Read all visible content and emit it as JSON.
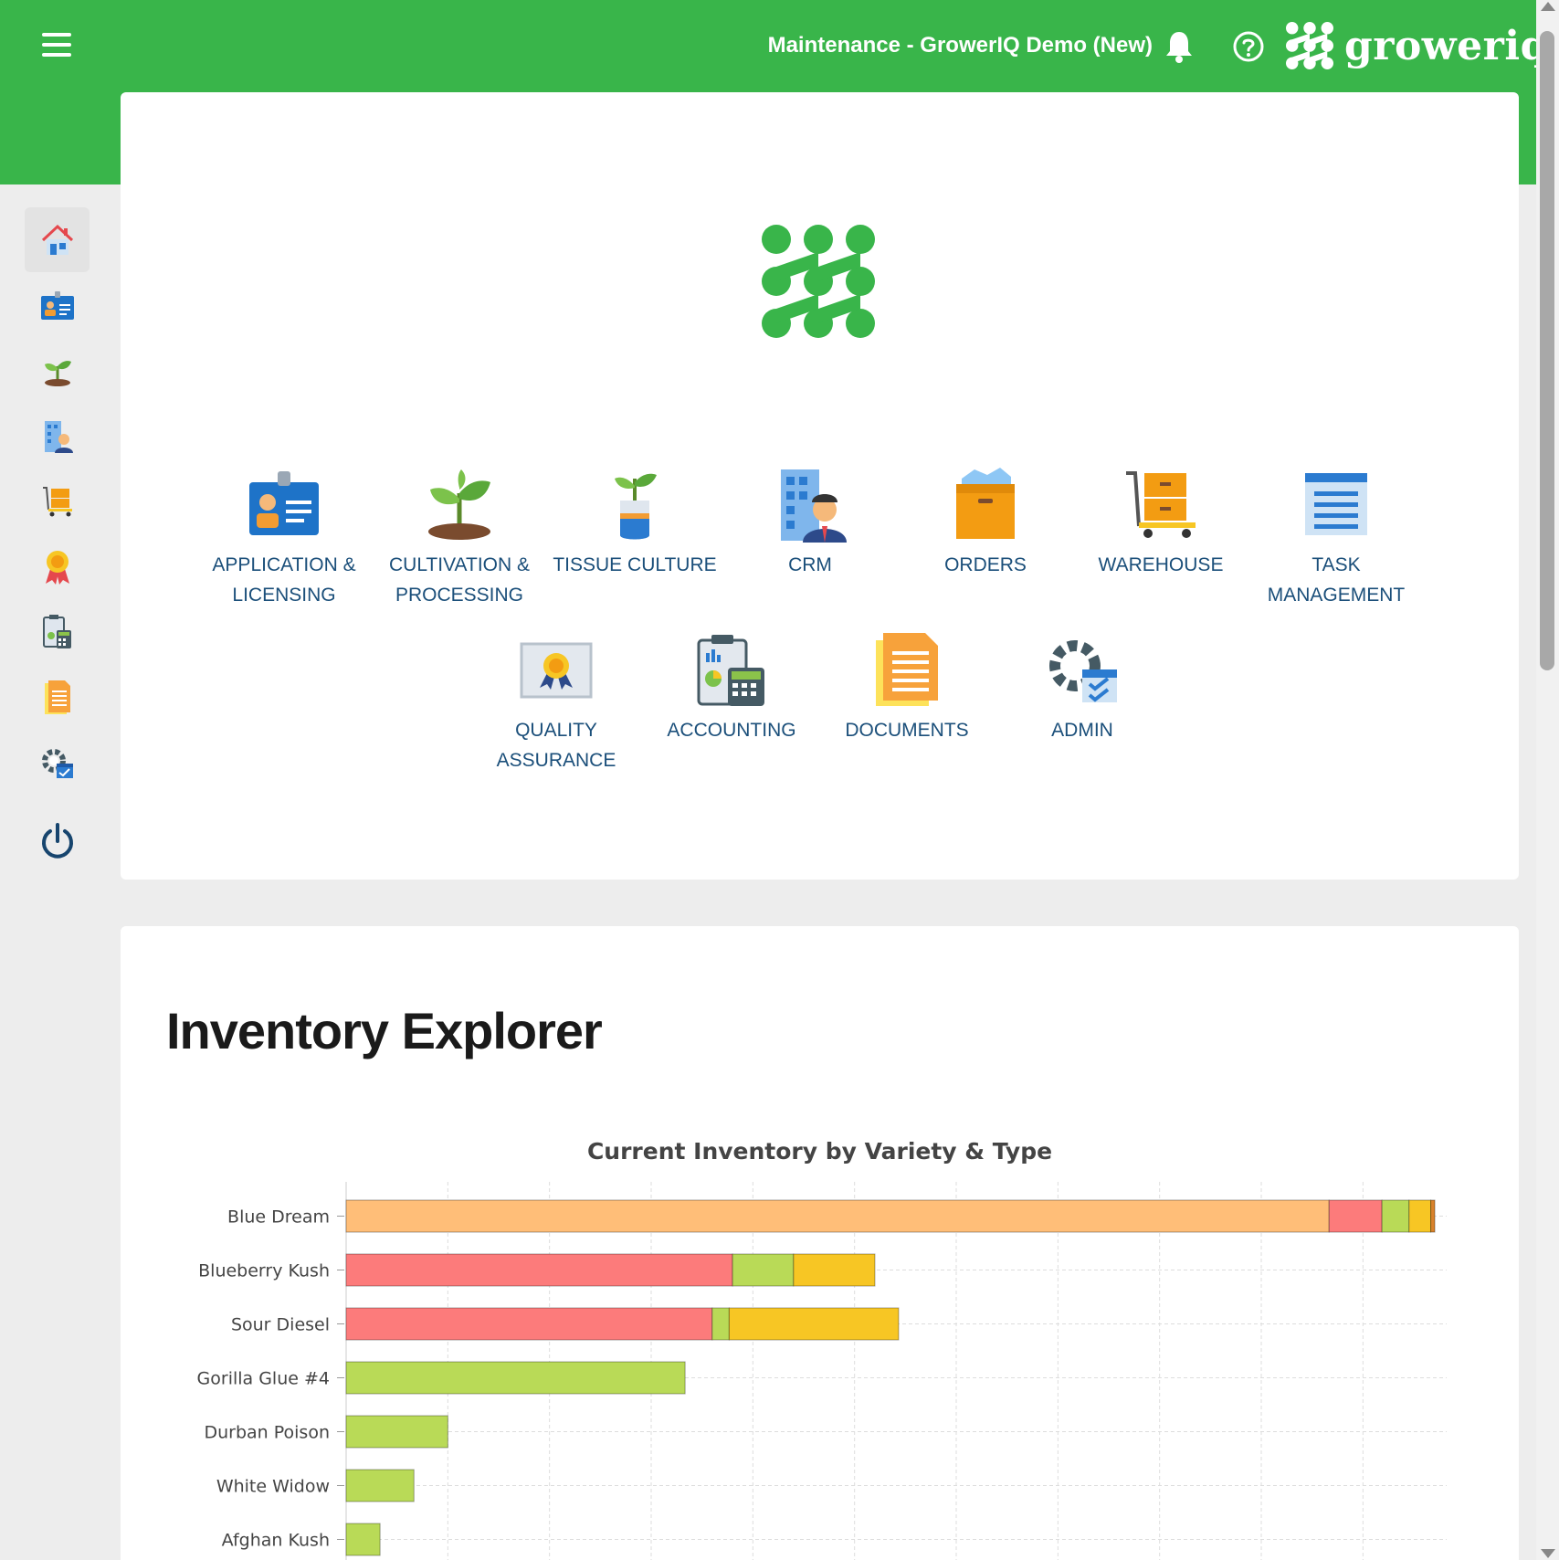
{
  "header": {
    "menu_icon": "hamburger-menu-icon",
    "environment_title": "Maintenance - GrowerIQ Demo (New)",
    "notification_icon": "bell-icon",
    "help_icon": "help-circle-icon",
    "brand_name": "groweriq",
    "bg_color": "#39b54a"
  },
  "sidebar": {
    "items": [
      {
        "icon": "home-icon",
        "active": true
      },
      {
        "icon": "id-card-icon"
      },
      {
        "icon": "plant-icon"
      },
      {
        "icon": "crm-building-person-icon"
      },
      {
        "icon": "warehouse-cart-icon"
      },
      {
        "icon": "award-ribbon-icon"
      },
      {
        "icon": "accounting-calculator-icon"
      },
      {
        "icon": "document-icon"
      },
      {
        "icon": "admin-gear-icon"
      },
      {
        "icon": "power-icon"
      }
    ]
  },
  "modules": [
    {
      "label": "APPLICATION & LICENSING",
      "icon": "id-card-icon"
    },
    {
      "label": "CULTIVATION & PROCESSING",
      "icon": "plant-icon"
    },
    {
      "label": "TISSUE CULTURE",
      "icon": "tissue-culture-icon"
    },
    {
      "label": "CRM",
      "icon": "crm-building-person-icon"
    },
    {
      "label": "ORDERS",
      "icon": "orders-box-icon"
    },
    {
      "label": "WAREHOUSE",
      "icon": "warehouse-cart-icon"
    },
    {
      "label": "TASK MANAGEMENT",
      "icon": "task-list-icon"
    },
    {
      "label": "QUALITY ASSURANCE",
      "icon": "quality-certificate-icon"
    },
    {
      "label": "ACCOUNTING",
      "icon": "accounting-calculator-icon"
    },
    {
      "label": "DOCUMENTS",
      "icon": "document-icon"
    },
    {
      "label": "ADMIN",
      "icon": "admin-gear-icon"
    }
  ],
  "inventory": {
    "heading": "Inventory Explorer"
  },
  "chart_data": {
    "type": "bar",
    "orientation": "horizontal",
    "stacked": true,
    "title": "Current Inventory by Variety & Type",
    "categories": [
      "Blue Dream",
      "Blueberry Kush",
      "Sour Diesel",
      "Gorilla Glue #4",
      "Durban Poison",
      "White Widow",
      "Afghan Kush"
    ],
    "series": [
      {
        "color": "#ffbe78",
        "values": [
          1450,
          0,
          0,
          0,
          0,
          0,
          0
        ]
      },
      {
        "color": "#fc7b7b",
        "values": [
          78,
          570,
          540,
          0,
          0,
          0,
          0
        ]
      },
      {
        "color": "#b9da57",
        "values": [
          40,
          90,
          25,
          500,
          150,
          100,
          50
        ]
      },
      {
        "color": "#f7c624",
        "values": [
          32,
          120,
          250,
          0,
          0,
          0,
          0
        ]
      },
      {
        "color": "#d9822b",
        "values": [
          6,
          0,
          0,
          0,
          0,
          0,
          0
        ]
      }
    ],
    "xlim": [
      0,
      1610
    ],
    "grid": true,
    "legend": "none visible"
  }
}
